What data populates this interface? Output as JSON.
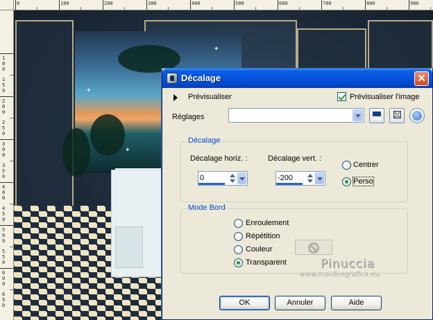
{
  "ruler": {
    "top_labels": [
      "0",
      "100",
      "200",
      "300",
      "400",
      "500",
      "600",
      "700",
      "800",
      "900"
    ],
    "left_labels": [
      "1",
      "0",
      "0",
      "1",
      "5",
      "0",
      "2",
      "0",
      "0",
      "2",
      "5",
      "0",
      "3",
      "0",
      "0",
      "3",
      "5",
      "0",
      "4",
      "0",
      "0",
      "4",
      "5",
      "0",
      "5",
      "0",
      "0",
      "5",
      "5",
      "0",
      "6",
      "0",
      "0",
      "6",
      "5",
      "0"
    ]
  },
  "dialog": {
    "title": "Décalage",
    "close_label": "✕",
    "preview_label": "Prévisualiser",
    "preview_image_label": "Prévisualiser l'image",
    "preview_image_checked": true,
    "settings_label": "Réglages",
    "settings_value": "",
    "offset_group": {
      "title": "Décalage",
      "horiz_label": "Décalage horiz. :",
      "horiz_value": "0",
      "vert_label": "Décalage vert. :",
      "vert_value": "-200",
      "center_label": "Centrer",
      "custom_label": "Perso",
      "selected": "Perso"
    },
    "border_group": {
      "title": "Mode Bord",
      "options": [
        "Enroulement",
        "Répétition",
        "Couleur",
        "Transparent"
      ],
      "selected": "Transparent"
    },
    "buttons": {
      "ok": "OK",
      "cancel": "Annuler",
      "help": "Aide"
    }
  },
  "watermark": {
    "name": "Pinuccia",
    "url": "www.maidiregrafica.eu"
  },
  "colors": {
    "titlebar": "#0552d9",
    "group_title": "#0046d5",
    "radio_checked": "#21a121"
  }
}
